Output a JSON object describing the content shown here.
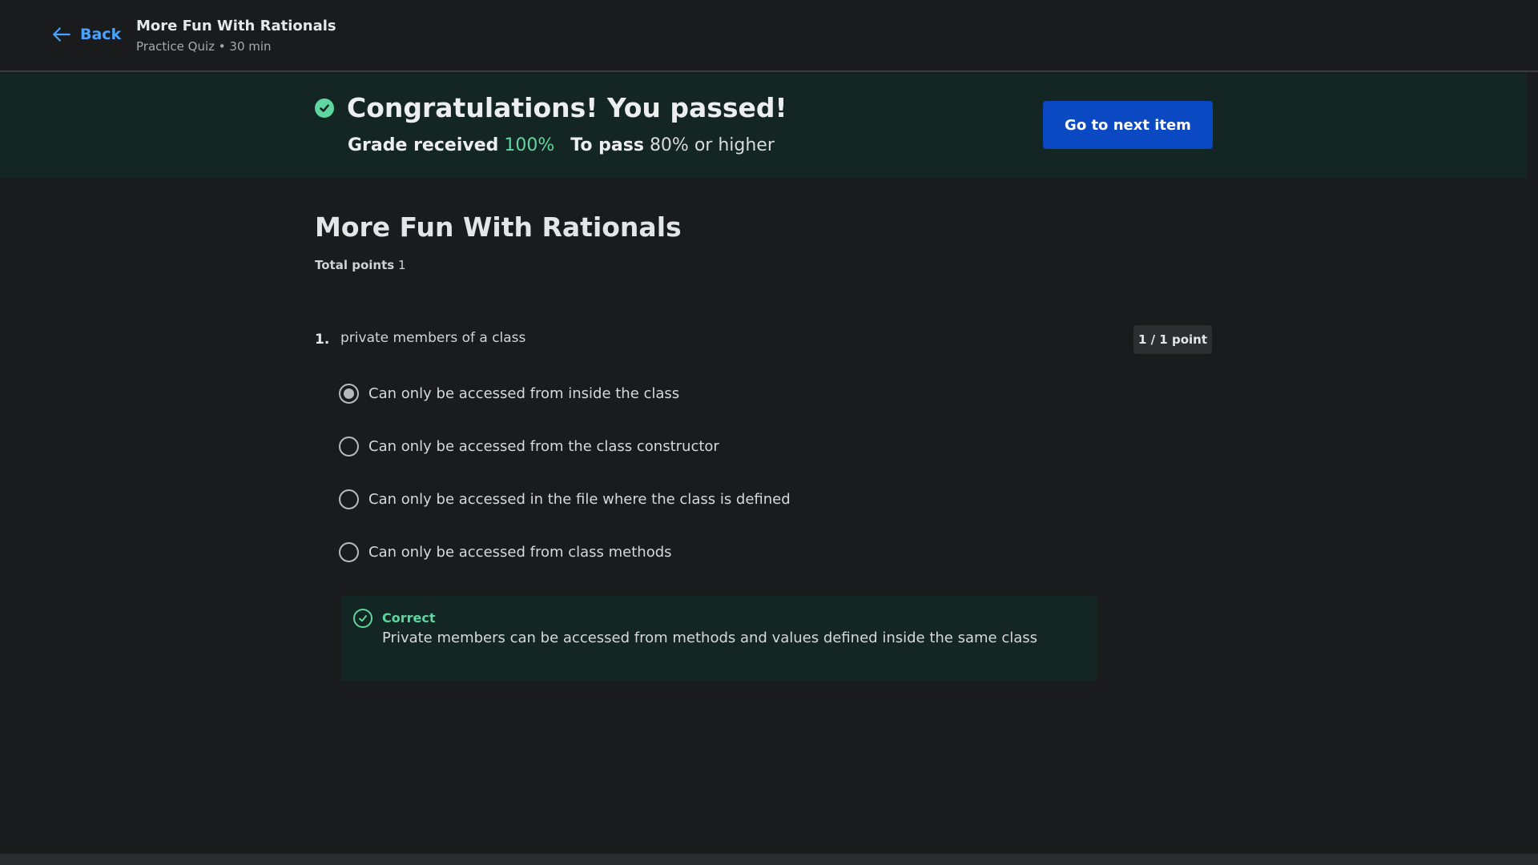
{
  "header": {
    "back_label": "Back",
    "title": "More Fun With Rationals",
    "subtitle": "Practice Quiz • 30 min"
  },
  "banner": {
    "heading": "Congratulations! You passed!",
    "grade_label": "Grade received",
    "grade_value": "100%",
    "pass_label": "To pass",
    "pass_value": "80% or higher",
    "next_button": "Go to next item"
  },
  "main": {
    "title": "More Fun With Rationals",
    "total_points_label": "Total points",
    "total_points_value": "1"
  },
  "question": {
    "number": "1.",
    "text": "private members of a class",
    "score": "1 / 1 point",
    "options": [
      {
        "label": "Can only be accessed from inside the class",
        "selected": true
      },
      {
        "label": "Can only be accessed from the class constructor",
        "selected": false
      },
      {
        "label": "Can only be accessed in the file where the class is defined",
        "selected": false
      },
      {
        "label": "Can only be accessed from class methods",
        "selected": false
      }
    ],
    "feedback": {
      "status": "Correct",
      "text": "Private members can be accessed from methods and values defined inside the same class"
    }
  },
  "colors": {
    "accent_blue": "#4aa3ff",
    "button_blue": "#0a49c2",
    "success_green": "#5fd6a0",
    "banner_bg": "#132623"
  },
  "icons": {
    "back": "arrow-left-icon",
    "pass": "check-circle-icon",
    "feedback": "check-circle-outline-icon"
  }
}
